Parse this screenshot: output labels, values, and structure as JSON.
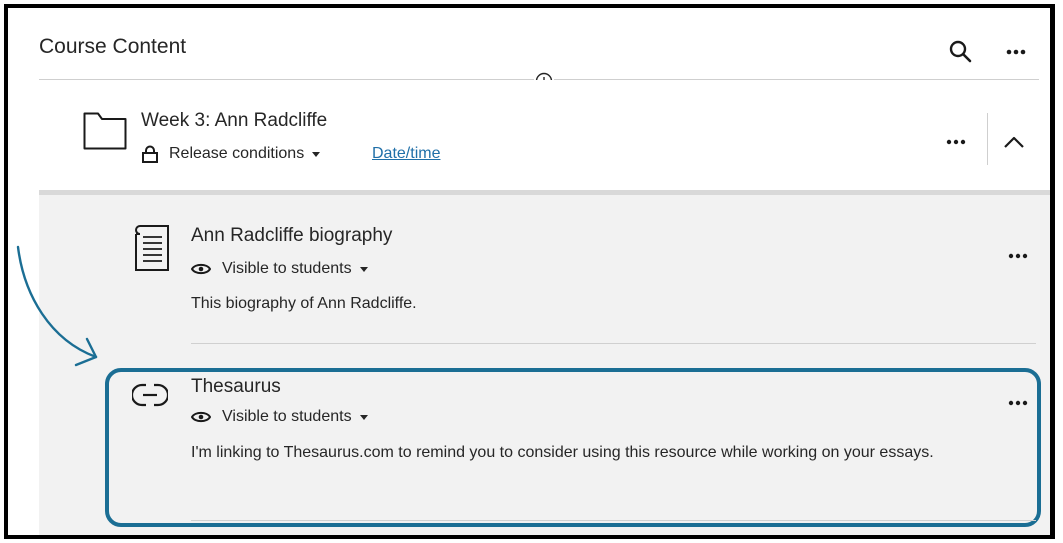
{
  "header": {
    "title": "Course Content"
  },
  "folder": {
    "title": "Week 3: Ann Radcliffe",
    "release_label": "Release conditions",
    "date_link": "Date/time"
  },
  "items": [
    {
      "title": "Ann Radcliffe biography",
      "visibility": "Visible to students",
      "description": "This biography of Ann Radcliffe."
    },
    {
      "title": "Thesaurus",
      "visibility": "Visible to students",
      "description": "I'm linking to Thesaurus.com to remind you to consider using this resource while working on your essays."
    }
  ],
  "colors": {
    "accent": "#1b6e94",
    "link": "#1f6fa8",
    "text": "#262626",
    "content_bg": "#f2f2f2"
  },
  "icons": [
    "search-icon",
    "more-icon",
    "add-circle-icon",
    "folder-icon",
    "lock-icon",
    "chevron-up-icon",
    "document-icon",
    "eye-icon",
    "link-icon",
    "arrow-annotation"
  ]
}
